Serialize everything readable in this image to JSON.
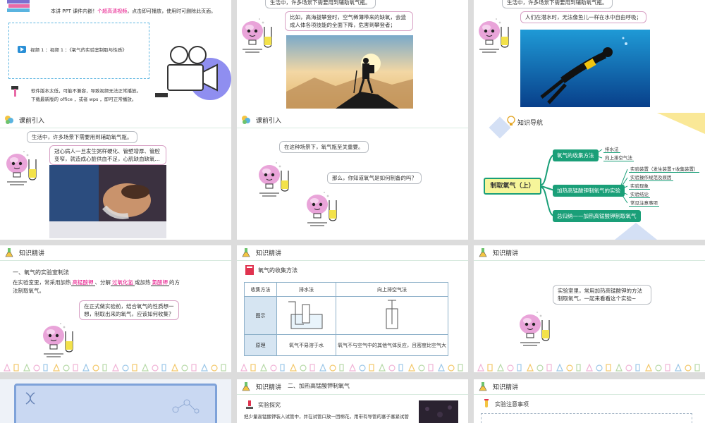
{
  "slide1": {
    "notice_prefix": "本讲 PPT 课件内嵌！",
    "notice_highlight": "个超高清视频",
    "notice_suffix": "，点击即可播放，使用时可删除此页面。",
    "video_label": "视频 1 ：视频 1 ：《氧气的实验室制取与性质》",
    "software_line1": "软件版本太低，可能不兼容，导致视频无法正常播放。",
    "software_line2": "下载最新版的 office ，或者 wps ，即可正常播放。"
  },
  "slide2": {
    "top_bubble": "生活中，许多场景下需要用到辅助氧气瓶。",
    "bubble": "比如，高海拔攀登时，空气稀薄带来的缺氧，会造成人体各项技能的全面下降，危害到攀登者；"
  },
  "slide3": {
    "top_bubble": "生活中，许多场景下需要用到辅助氧气瓶。",
    "bubble": "人们在潜水时，无法像鱼儿一样在水中自由呼吸；"
  },
  "slide4": {
    "header": "课前引入",
    "top_bubble": "生活中，许多场景下需要用到辅助氧气瓶。",
    "bubble": "冠心病人一旦发生粥样硬化、管壁增厚、管腔变窄，就造成心脏供血不足，心肌缺血缺氧..."
  },
  "slide5": {
    "header": "课前引入",
    "bubble1": "在这种场景下，氧气瓶至关重要。",
    "bubble2": "那么，你知道氧气是如何制备的吗？"
  },
  "slide6": {
    "header": "知识导航",
    "root": "制取氧气（上）",
    "branch1": "氧气的收集方法",
    "branch1_leaves": [
      "排水法",
      "向上排空气法"
    ],
    "branch2": "加热高锰酸钾制氧气的实验",
    "branch2_leaves": [
      "实验装置（发生装置+收集装置）",
      "实验操作规范及原因",
      "实验现象",
      "实验结论",
      "常见注意事项"
    ],
    "branch3": "总归纳——加热高锰酸钾制取氧气"
  },
  "slide7": {
    "header": "知识精讲",
    "section": "一、氧气的实验室制法",
    "line1_a": "在实验室里，常采用加热",
    "blank1": "高锰酸钾",
    "line1_b": "、分解",
    "blank2": "过氧化氢",
    "line1_c": "或加热",
    "blank3": "氯酸钾",
    "line1_d": "的方",
    "line2": "法制取氧气。",
    "bubble": "在正式做实验前，结合氧气的性质想一想，制取出来的氧气，应该如何收集？"
  },
  "slide8": {
    "header": "知识精讲",
    "title": "氧气的收集方法",
    "table": {
      "head": [
        "收集方法",
        "排水法",
        "向上排空气法"
      ],
      "row_diagram_label": "图示",
      "row_principle_label": "原理",
      "principle_water": "氧气不易溶于水",
      "principle_air": "氧气不与空气中的其他气体反应，且密度比空气大"
    }
  },
  "slide9": {
    "header": "知识精讲",
    "bubble": "实验室里，常用加热高锰酸钾的方法制取氧气，一起来看看这个实验~"
  },
  "slide11": {
    "header": "知识精讲",
    "subheader": "二、加热高锰酸钾制氧气",
    "title": "实验探究",
    "line": "把少量高锰酸钾装入试管中，并在试管口放一团棉花，用带有导管的塞子塞紧试管"
  },
  "slide12": {
    "header": "知识精讲",
    "title": "实验注意事项"
  },
  "colors": {
    "accent_pink": "#e4007f",
    "mind_green": "#1a9f78",
    "root_yellow": "#f6f59a",
    "header_line": "#d8eadf"
  }
}
